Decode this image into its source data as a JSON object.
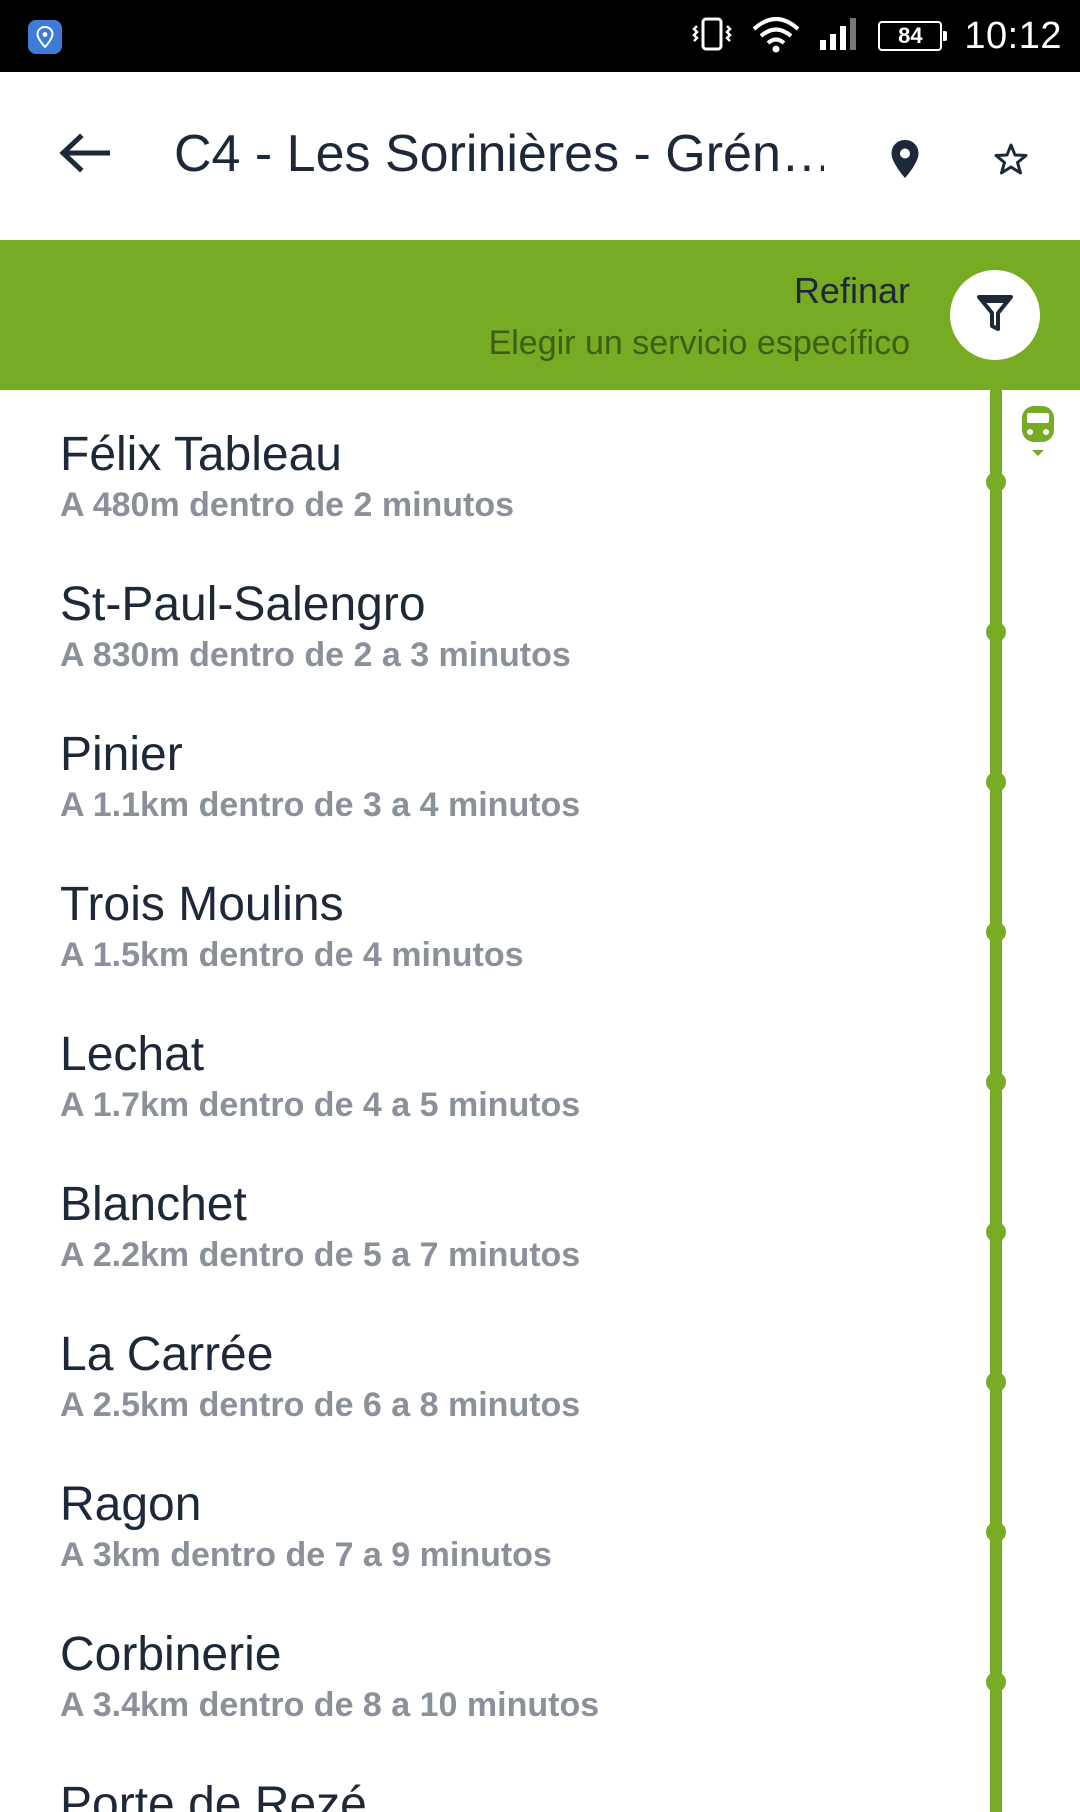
{
  "status_bar": {
    "battery": "84",
    "time": "10:12"
  },
  "header": {
    "title": "C4 - Les Sorinières - Grén…"
  },
  "refine": {
    "title": "Refinar",
    "subtitle": "Elegir un servicio específico"
  },
  "stops": [
    {
      "name": "Félix Tableau",
      "detail": "A 480m dentro de 2 minutos"
    },
    {
      "name": "St-Paul-Salengro",
      "detail": "A 830m dentro de 2 a 3 minutos"
    },
    {
      "name": "Pinier",
      "detail": "A 1.1km dentro de 3 a 4 minutos"
    },
    {
      "name": "Trois Moulins",
      "detail": "A 1.5km dentro de 4 minutos"
    },
    {
      "name": "Lechat",
      "detail": "A 1.7km dentro de 4 a 5 minutos"
    },
    {
      "name": "Blanchet",
      "detail": "A 2.2km dentro de 5 a 7 minutos"
    },
    {
      "name": "La Carrée",
      "detail": "A 2.5km dentro de 6 a 8 minutos"
    },
    {
      "name": "Ragon",
      "detail": "A 3km dentro de 7 a 9 minutos"
    },
    {
      "name": "Corbinerie",
      "detail": "A 3.4km dentro de 8 a 10 minutos"
    },
    {
      "name": "Porte de Rezé",
      "detail": ""
    }
  ],
  "colors": {
    "accent": "#77ab24",
    "title_text": "#1d2838",
    "detail_text": "#8a919b"
  },
  "icons": {
    "back": "arrow-left-icon",
    "map": "map-pin-icon",
    "favorite": "star-icon",
    "filter": "filter-icon",
    "vehicle": "bus-icon"
  }
}
